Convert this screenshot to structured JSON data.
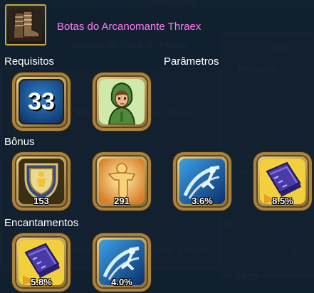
{
  "background": {
    "texts": [
      "Calculadora",
      "Sapatos de Ferro do Thraex",
      "ador",
      "Proscrito",
      "Botinas do Templário Thraex",
      "Sapatos do Arcanomante Thraex",
      "Nív"
    ],
    "numbers": [
      "35",
      "0",
      "0",
      "3600"
    ]
  },
  "item": {
    "icon": "iron-boots-icon",
    "name": "Botas do Arcanomante Thraex"
  },
  "requirements": {
    "label": "Requisitos",
    "level": "33"
  },
  "parameters": {
    "label": "Parâmetros",
    "icon": "character-portrait-icon"
  },
  "bonus": {
    "label": "Bônus",
    "items": [
      {
        "icon": "defense-shield-icon",
        "value": "153"
      },
      {
        "icon": "health-body-icon",
        "value": "291"
      },
      {
        "icon": "evasion-icon",
        "value": "3.6%"
      },
      {
        "icon": "spellbook-icon",
        "value": "8.5%"
      }
    ]
  },
  "enchantments": {
    "label": "Encantamentos",
    "items": [
      {
        "icon": "spellbook-icon",
        "value": "5.8%"
      },
      {
        "icon": "evasion-icon",
        "value": "4.0%"
      }
    ]
  },
  "colors": {
    "title": "#ff7cf3",
    "slot_border": "#a8823e"
  }
}
